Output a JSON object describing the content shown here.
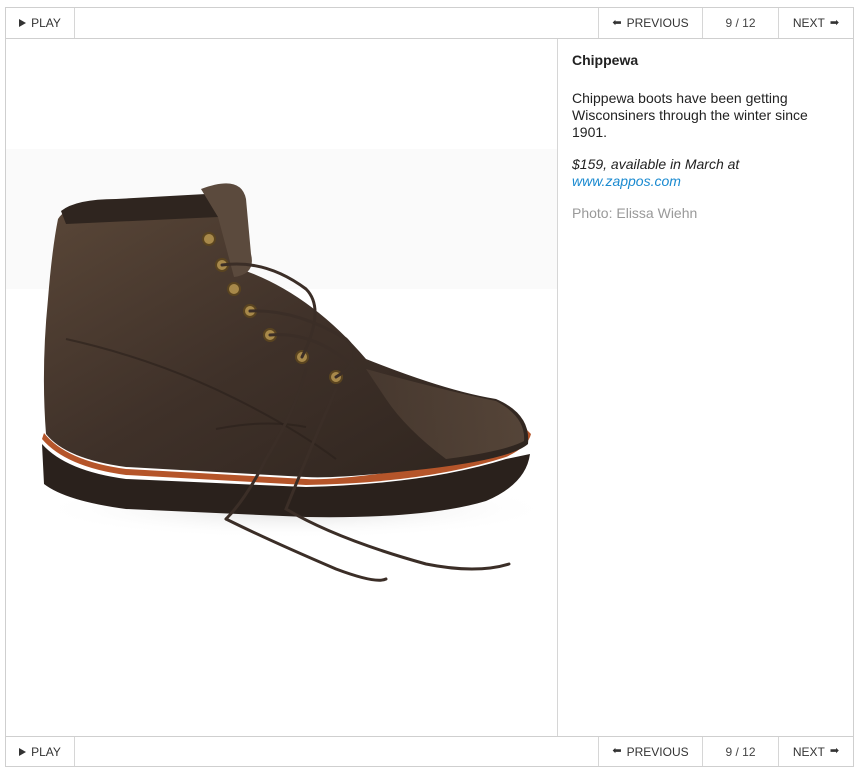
{
  "controls": {
    "play_label": "PLAY",
    "previous_label": "PREVIOUS",
    "next_label": "NEXT",
    "counter": "9 / 12"
  },
  "slide": {
    "title": "Chippewa",
    "description": "Chippewa boots have been getting Wisconsiners through the winter since 1901.",
    "price_text": "$159, available in March at",
    "link_text": "www.zappos.com",
    "credit": "Photo: Elissa Wiehn",
    "image_subject": "brown leather lace-up work boot"
  },
  "colors": {
    "link": "#1a8ad0",
    "credit": "#999999",
    "border": "#cfcfcf",
    "boot_leather": "#4a3a30",
    "welt": "#b5552a"
  }
}
